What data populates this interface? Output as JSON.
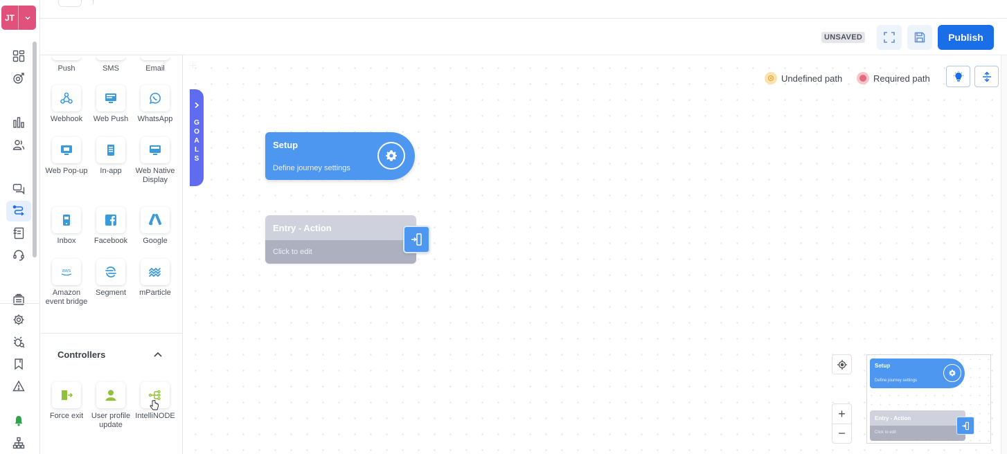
{
  "user": {
    "initials": "JT"
  },
  "header": {
    "status_badge": "UNSAVED",
    "publish_label": "Publish"
  },
  "palette": {
    "top_row": [
      "Push",
      "SMS",
      "Email"
    ],
    "channels": [
      {
        "label": "Webhook",
        "icon": "webhook-icon"
      },
      {
        "label": "Web Push",
        "icon": "web-push-icon"
      },
      {
        "label": "WhatsApp",
        "icon": "whatsapp-icon"
      },
      {
        "label": "Web Pop-up",
        "icon": "web-popup-icon"
      },
      {
        "label": "In-app",
        "icon": "in-app-icon"
      },
      {
        "label": "Web Native Display",
        "icon": "web-native-display-icon"
      },
      {
        "label": "Inbox",
        "icon": "inbox-icon"
      },
      {
        "label": "Facebook",
        "icon": "facebook-icon"
      },
      {
        "label": "Google",
        "icon": "google-icon"
      },
      {
        "label": "Amazon event bridge",
        "icon": "aws-icon"
      },
      {
        "label": "Segment",
        "icon": "segment-icon"
      },
      {
        "label": "mParticle",
        "icon": "mparticle-icon"
      }
    ],
    "controllers": {
      "title": "Controllers",
      "items": [
        {
          "label": "Force exit",
          "icon": "force-exit-icon"
        },
        {
          "label": "User profile update",
          "icon": "user-profile-icon"
        },
        {
          "label": "IntelliNODE",
          "icon": "intellinode-icon"
        }
      ]
    }
  },
  "goals_tab": {
    "label": "GOALS"
  },
  "legend": {
    "undefined_path": "Undefined path",
    "required_path": "Required path"
  },
  "nodes": {
    "setup": {
      "title": "Setup",
      "subtitle": "Define journey settings"
    },
    "entry": {
      "title": "Entry - Action",
      "subtitle": "Click to edit"
    }
  },
  "minimap": {
    "setup_title": "Setup",
    "setup_subtitle": "Define journey settings",
    "entry_title": "Entry - Action",
    "entry_subtitle": "Click to edit"
  },
  "zoom": {
    "in": "+",
    "out": "−"
  },
  "colors": {
    "primary": "#1a6fe8",
    "node_blue": "#4e97f0",
    "goals_purple": "#5f6cf0",
    "avatar_pink": "#e0527c",
    "undefined_path": "#f5c26b",
    "required_path": "#e46b7a",
    "controller_green": "#8fc13b"
  }
}
